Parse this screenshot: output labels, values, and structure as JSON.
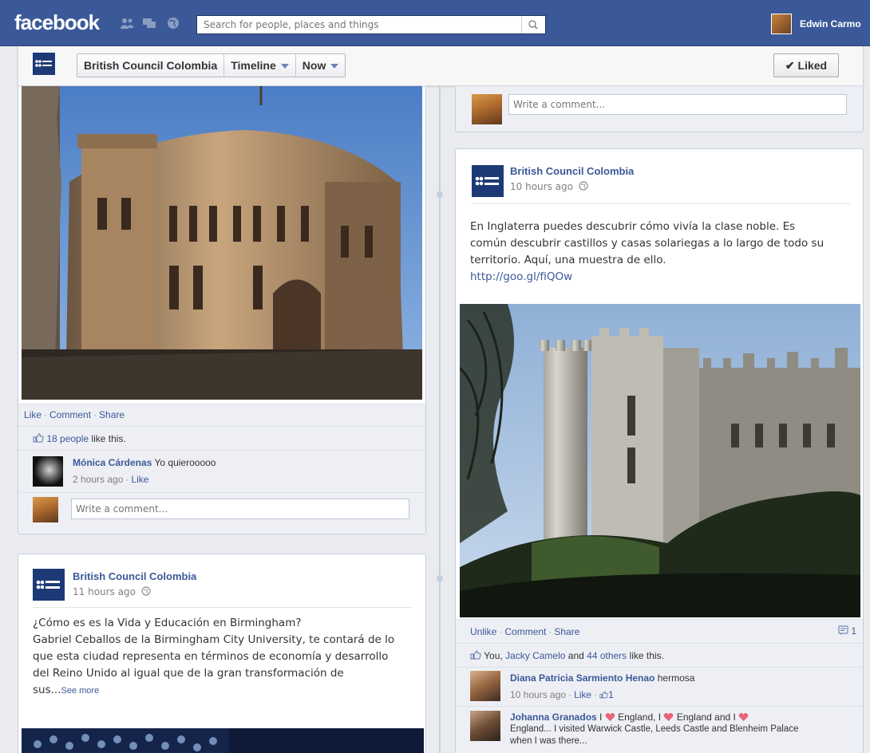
{
  "topbar": {
    "logo": "facebook",
    "search_placeholder": "Search for people, places and things",
    "user_name": "Edwin Carmo"
  },
  "page_header": {
    "page_name": "British Council Colombia",
    "timeline_label": "Timeline",
    "now_label": "Now",
    "liked_label": "✔ Liked"
  },
  "left_post_1": {
    "image_alt": "Victorian sandstone building at sunset",
    "actions": {
      "like": "Like",
      "comment": "Comment",
      "share": "Share"
    },
    "likes": {
      "people": "18 people",
      "suffix": "like this."
    },
    "comment": {
      "author": "Mónica Cárdenas",
      "text": "Yo quierooooo",
      "time": "2 hours ago",
      "like": "Like"
    },
    "write_placeholder": "Write a comment..."
  },
  "left_post_2": {
    "author": "British Council Colombia",
    "time": "11 hours ago",
    "text_lines": [
      "¿Cómo es es la Vida y Educación en Birmingham?",
      "Gabriel Ceballos de la Birmingham City University, te contará de lo",
      "que esta ciudad representa en términos de economía y desarrollo",
      "del Reino Unido al igual que de la gran transformación de"
    ],
    "truncated": "sus...",
    "see_more": "See more"
  },
  "right_top": {
    "write_placeholder": "Write a comment..."
  },
  "right_post": {
    "author": "British Council Colombia",
    "time": "10 hours ago",
    "text_lines": [
      "En Inglaterra puedes descubrir cómo vivía la clase noble. Es",
      "común descubrir castillos y casas solariegas a lo largo de todo su",
      "territorio. Aquí, una muestra de ello."
    ],
    "link": "http://goo.gl/fiQOw",
    "actions": {
      "unlike": "Unlike",
      "comment": "Comment",
      "share": "Share",
      "comment_count": "1"
    },
    "likes": {
      "you": "You,",
      "friend": "Jacky Camelo",
      "and": "and",
      "others": "44 others",
      "suffix": "like this."
    },
    "comments": [
      {
        "author": "Diana Patricia Sarmiento Henao",
        "text": "hermosa",
        "time": "10 hours ago",
        "like": "Like",
        "likes": "1"
      },
      {
        "author": "Johanna Granados",
        "text1": "I",
        "text2": "England, I",
        "text3": "England and I",
        "line2": "England... I visited Warwick Castle, Leeds Castle and Blenheim Palace",
        "line3": "when I was there..."
      }
    ]
  },
  "colors": {
    "brand": "#3b5998",
    "bg": "#e9ebee",
    "link": "#3b5998",
    "heart": "#e9637a"
  }
}
